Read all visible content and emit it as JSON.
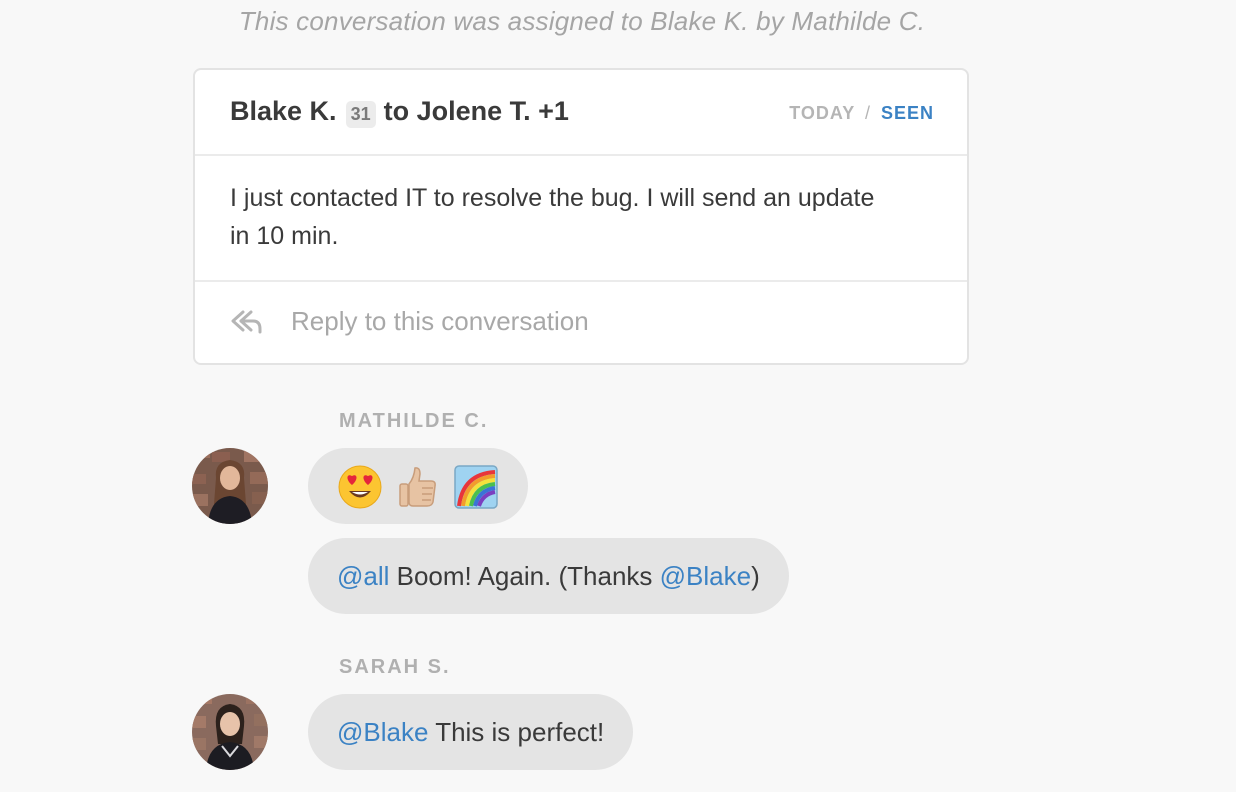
{
  "system_note": "This conversation was assigned to Blake K. by Mathilde C.",
  "card": {
    "sender": "Blake K.",
    "sender_badge": "31",
    "recipients": "to Jolene T. +1",
    "date": "TODAY",
    "separator": "/",
    "status": "SEEN",
    "body": "I just contacted IT to resolve the bug. I will send an update in 10 min.",
    "reply_placeholder": "Reply to this conversation",
    "reply_icon": "reply-all-icon"
  },
  "messages": [
    {
      "author": "MATHILDE C.",
      "avatar": "mathilde-avatar",
      "bubbles": [
        {
          "type": "emoji",
          "items": [
            "heart-eyes-emoji",
            "thumbs-up-emoji",
            "rainbow-emoji"
          ]
        },
        {
          "type": "text",
          "mention": "@all",
          "text_before": " Boom! Again. (Thanks ",
          "mention2": "@Blake",
          "text_after": ")"
        }
      ]
    },
    {
      "author": "SARAH S.",
      "avatar": "sarah-avatar",
      "bubbles": [
        {
          "type": "text",
          "mention": "@Blake",
          "text_before": " This is perfect!"
        }
      ]
    }
  ],
  "colors": {
    "background": "#f8f8f8",
    "card_border": "#e3e3e3",
    "bubble": "#e4e4e4",
    "mention": "#3b82c4",
    "muted": "#a8a8a8"
  }
}
